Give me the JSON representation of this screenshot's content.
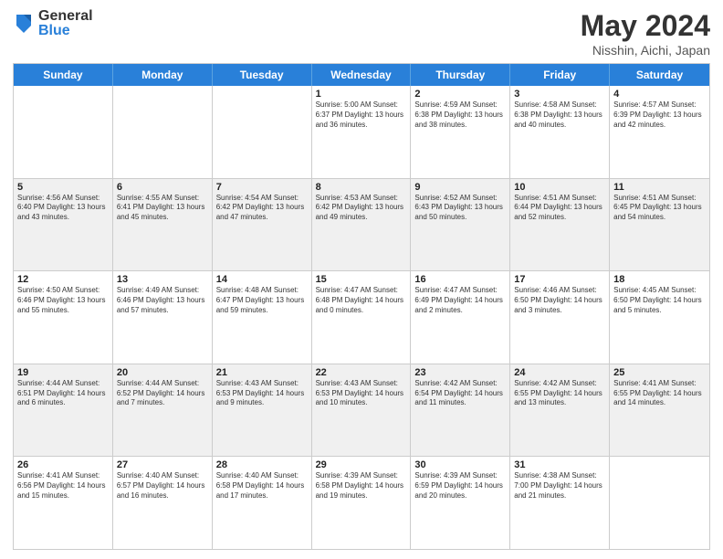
{
  "logo": {
    "general": "General",
    "blue": "Blue"
  },
  "header": {
    "title": "May 2024",
    "subtitle": "Nisshin, Aichi, Japan"
  },
  "weekdays": [
    "Sunday",
    "Monday",
    "Tuesday",
    "Wednesday",
    "Thursday",
    "Friday",
    "Saturday"
  ],
  "rows": [
    [
      {
        "day": "",
        "info": ""
      },
      {
        "day": "",
        "info": ""
      },
      {
        "day": "",
        "info": ""
      },
      {
        "day": "1",
        "info": "Sunrise: 5:00 AM\nSunset: 6:37 PM\nDaylight: 13 hours\nand 36 minutes."
      },
      {
        "day": "2",
        "info": "Sunrise: 4:59 AM\nSunset: 6:38 PM\nDaylight: 13 hours\nand 38 minutes."
      },
      {
        "day": "3",
        "info": "Sunrise: 4:58 AM\nSunset: 6:38 PM\nDaylight: 13 hours\nand 40 minutes."
      },
      {
        "day": "4",
        "info": "Sunrise: 4:57 AM\nSunset: 6:39 PM\nDaylight: 13 hours\nand 42 minutes."
      }
    ],
    [
      {
        "day": "5",
        "info": "Sunrise: 4:56 AM\nSunset: 6:40 PM\nDaylight: 13 hours\nand 43 minutes."
      },
      {
        "day": "6",
        "info": "Sunrise: 4:55 AM\nSunset: 6:41 PM\nDaylight: 13 hours\nand 45 minutes."
      },
      {
        "day": "7",
        "info": "Sunrise: 4:54 AM\nSunset: 6:42 PM\nDaylight: 13 hours\nand 47 minutes."
      },
      {
        "day": "8",
        "info": "Sunrise: 4:53 AM\nSunset: 6:42 PM\nDaylight: 13 hours\nand 49 minutes."
      },
      {
        "day": "9",
        "info": "Sunrise: 4:52 AM\nSunset: 6:43 PM\nDaylight: 13 hours\nand 50 minutes."
      },
      {
        "day": "10",
        "info": "Sunrise: 4:51 AM\nSunset: 6:44 PM\nDaylight: 13 hours\nand 52 minutes."
      },
      {
        "day": "11",
        "info": "Sunrise: 4:51 AM\nSunset: 6:45 PM\nDaylight: 13 hours\nand 54 minutes."
      }
    ],
    [
      {
        "day": "12",
        "info": "Sunrise: 4:50 AM\nSunset: 6:46 PM\nDaylight: 13 hours\nand 55 minutes."
      },
      {
        "day": "13",
        "info": "Sunrise: 4:49 AM\nSunset: 6:46 PM\nDaylight: 13 hours\nand 57 minutes."
      },
      {
        "day": "14",
        "info": "Sunrise: 4:48 AM\nSunset: 6:47 PM\nDaylight: 13 hours\nand 59 minutes."
      },
      {
        "day": "15",
        "info": "Sunrise: 4:47 AM\nSunset: 6:48 PM\nDaylight: 14 hours\nand 0 minutes."
      },
      {
        "day": "16",
        "info": "Sunrise: 4:47 AM\nSunset: 6:49 PM\nDaylight: 14 hours\nand 2 minutes."
      },
      {
        "day": "17",
        "info": "Sunrise: 4:46 AM\nSunset: 6:50 PM\nDaylight: 14 hours\nand 3 minutes."
      },
      {
        "day": "18",
        "info": "Sunrise: 4:45 AM\nSunset: 6:50 PM\nDaylight: 14 hours\nand 5 minutes."
      }
    ],
    [
      {
        "day": "19",
        "info": "Sunrise: 4:44 AM\nSunset: 6:51 PM\nDaylight: 14 hours\nand 6 minutes."
      },
      {
        "day": "20",
        "info": "Sunrise: 4:44 AM\nSunset: 6:52 PM\nDaylight: 14 hours\nand 7 minutes."
      },
      {
        "day": "21",
        "info": "Sunrise: 4:43 AM\nSunset: 6:53 PM\nDaylight: 14 hours\nand 9 minutes."
      },
      {
        "day": "22",
        "info": "Sunrise: 4:43 AM\nSunset: 6:53 PM\nDaylight: 14 hours\nand 10 minutes."
      },
      {
        "day": "23",
        "info": "Sunrise: 4:42 AM\nSunset: 6:54 PM\nDaylight: 14 hours\nand 11 minutes."
      },
      {
        "day": "24",
        "info": "Sunrise: 4:42 AM\nSunset: 6:55 PM\nDaylight: 14 hours\nand 13 minutes."
      },
      {
        "day": "25",
        "info": "Sunrise: 4:41 AM\nSunset: 6:55 PM\nDaylight: 14 hours\nand 14 minutes."
      }
    ],
    [
      {
        "day": "26",
        "info": "Sunrise: 4:41 AM\nSunset: 6:56 PM\nDaylight: 14 hours\nand 15 minutes."
      },
      {
        "day": "27",
        "info": "Sunrise: 4:40 AM\nSunset: 6:57 PM\nDaylight: 14 hours\nand 16 minutes."
      },
      {
        "day": "28",
        "info": "Sunrise: 4:40 AM\nSunset: 6:58 PM\nDaylight: 14 hours\nand 17 minutes."
      },
      {
        "day": "29",
        "info": "Sunrise: 4:39 AM\nSunset: 6:58 PM\nDaylight: 14 hours\nand 19 minutes."
      },
      {
        "day": "30",
        "info": "Sunrise: 4:39 AM\nSunset: 6:59 PM\nDaylight: 14 hours\nand 20 minutes."
      },
      {
        "day": "31",
        "info": "Sunrise: 4:38 AM\nSunset: 7:00 PM\nDaylight: 14 hours\nand 21 minutes."
      },
      {
        "day": "",
        "info": ""
      }
    ]
  ]
}
